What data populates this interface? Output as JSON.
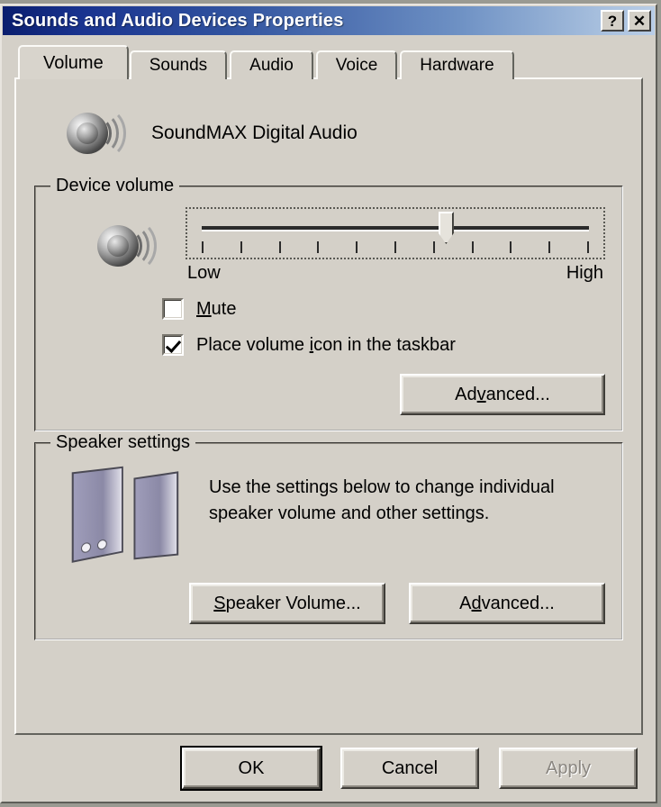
{
  "window": {
    "title": "Sounds and Audio Devices Properties",
    "caption_buttons": [
      {
        "name": "help-button",
        "glyph": "?"
      },
      {
        "name": "close-button",
        "glyph": "✕"
      }
    ],
    "titlebar_gradient_start": "#0a1e6e",
    "titlebar_gradient_end": "#b9cde6",
    "face_color": "#d4d0c8"
  },
  "tabs": [
    {
      "label": "Volume",
      "active": true
    },
    {
      "label": "Sounds",
      "active": false
    },
    {
      "label": "Audio",
      "active": false
    },
    {
      "label": "Voice",
      "active": false
    },
    {
      "label": "Hardware",
      "active": false
    }
  ],
  "device": {
    "name": "SoundMAX Digital Audio",
    "icon": "speaker-cone-icon"
  },
  "device_volume": {
    "title": "Device volume",
    "icon": "speaker-cone-icon",
    "slider": {
      "value_percent": 63,
      "tick_count": 11,
      "focused": true
    },
    "low_label": "Low",
    "high_label": "High",
    "mute": {
      "label": "Mute",
      "accelerator": "M",
      "checked": false
    },
    "taskbar_icon": {
      "label_before": "Place volume ",
      "accelerator": "i",
      "label_after": "con in the taskbar",
      "checked": true
    },
    "advanced_button": {
      "label_before": "Ad",
      "accelerator": "v",
      "label_after": "anced...",
      "enabled": true
    }
  },
  "speaker_settings": {
    "title": "Speaker settings",
    "icon": "desktop-speakers-icon",
    "description_line1": "Use the settings below to change individual",
    "description_line2": "speaker volume and other settings.",
    "speaker_volume_button": {
      "label_before": "",
      "accelerator": "S",
      "label_after": "peaker Volume...",
      "enabled": true
    },
    "advanced_button": {
      "label_before": "A",
      "accelerator": "d",
      "label_after": "vanced...",
      "enabled": true
    }
  },
  "dialog_buttons": [
    {
      "label": "OK",
      "default": true,
      "enabled": true
    },
    {
      "label": "Cancel",
      "default": false,
      "enabled": true
    },
    {
      "label": "Apply",
      "default": false,
      "enabled": false
    }
  ]
}
